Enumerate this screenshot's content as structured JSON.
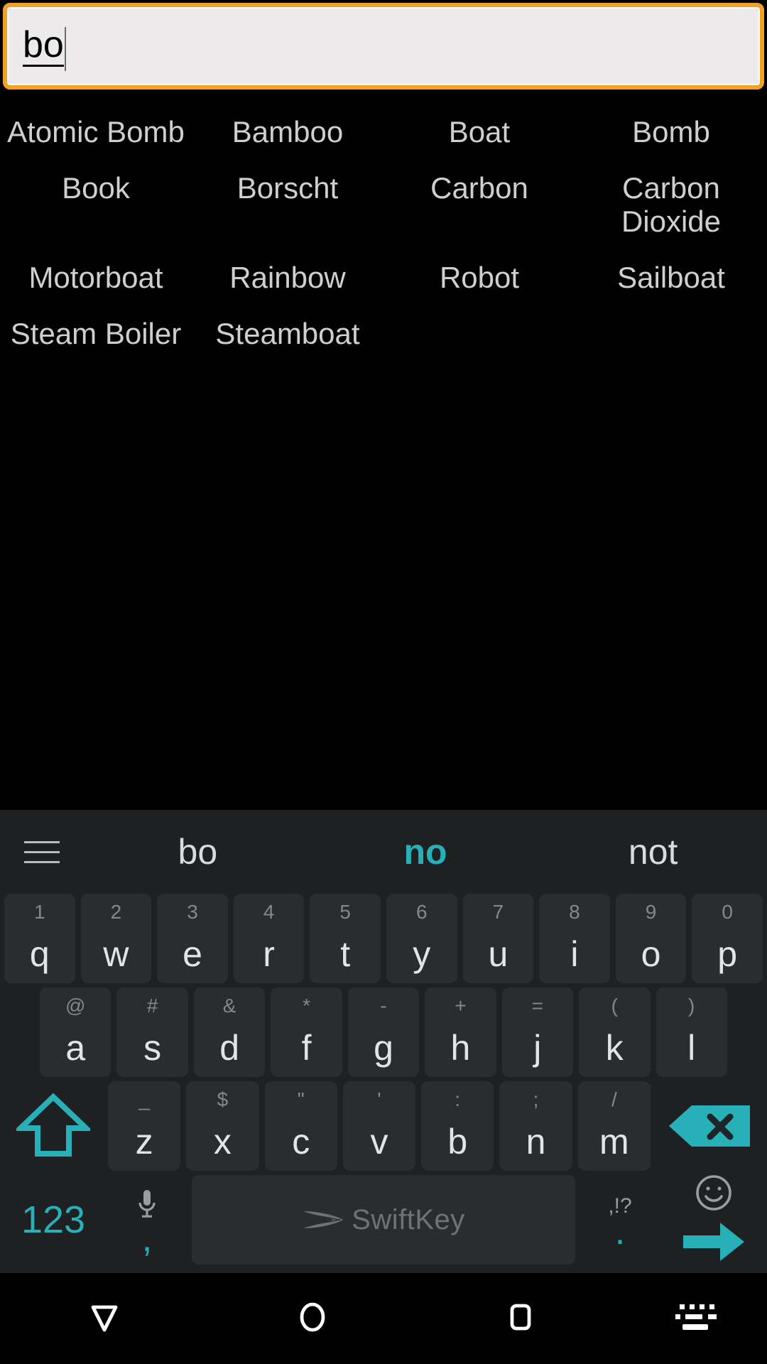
{
  "search": {
    "value": "bo",
    "placeholder": "",
    "border_color": "#f5a01e",
    "background": "#eceaea"
  },
  "results": {
    "rows": [
      [
        "Atomic Bomb",
        "Bamboo",
        "Boat",
        "Bomb"
      ],
      [
        "Book",
        "Borscht",
        "Carbon",
        "Carbon Dioxide"
      ],
      [
        "Motorboat",
        "Rainbow",
        "Robot",
        "Sailboat"
      ],
      [
        "Steam Boiler",
        "Steamboat",
        "",
        ""
      ]
    ]
  },
  "keyboard": {
    "accent_color": "#27b0b8",
    "menu_icon": "hamburger-menu-icon",
    "suggestions": [
      {
        "label": "bo",
        "active": false
      },
      {
        "label": "no",
        "active": true
      },
      {
        "label": "not",
        "active": false
      }
    ],
    "rows": [
      [
        {
          "main": "q",
          "hint": "1"
        },
        {
          "main": "w",
          "hint": "2"
        },
        {
          "main": "e",
          "hint": "3"
        },
        {
          "main": "r",
          "hint": "4"
        },
        {
          "main": "t",
          "hint": "5"
        },
        {
          "main": "y",
          "hint": "6"
        },
        {
          "main": "u",
          "hint": "7"
        },
        {
          "main": "i",
          "hint": "8"
        },
        {
          "main": "o",
          "hint": "9"
        },
        {
          "main": "p",
          "hint": "0"
        }
      ],
      [
        {
          "main": "a",
          "hint": "@"
        },
        {
          "main": "s",
          "hint": "#"
        },
        {
          "main": "d",
          "hint": "&"
        },
        {
          "main": "f",
          "hint": "*"
        },
        {
          "main": "g",
          "hint": "-"
        },
        {
          "main": "h",
          "hint": "+"
        },
        {
          "main": "j",
          "hint": "="
        },
        {
          "main": "k",
          "hint": "("
        },
        {
          "main": "l",
          "hint": ")"
        }
      ],
      [
        {
          "main": "z",
          "hint": "_"
        },
        {
          "main": "x",
          "hint": "$"
        },
        {
          "main": "c",
          "hint": "\""
        },
        {
          "main": "v",
          "hint": "'"
        },
        {
          "main": "b",
          "hint": ":"
        },
        {
          "main": "n",
          "hint": ";"
        },
        {
          "main": "m",
          "hint": "/"
        }
      ]
    ],
    "shift_label": "shift-key",
    "backspace_label": "backspace-key",
    "numeric_label": "123",
    "comma_key": {
      "main": ",",
      "hint": "microphone-icon"
    },
    "spacebar_brand": "SwiftKey",
    "period_key": {
      "main": ".",
      "hint": ",!?"
    },
    "enter_key": {
      "emoji_hint": "smiley-icon",
      "action": "enter-arrow"
    }
  },
  "navbar": {
    "items": [
      {
        "name": "back",
        "icon": "back-triangle-icon"
      },
      {
        "name": "home",
        "icon": "home-circle-icon"
      },
      {
        "name": "recents",
        "icon": "recents-square-icon"
      },
      {
        "name": "keyboard-switch",
        "icon": "keyboard-icon"
      }
    ]
  }
}
